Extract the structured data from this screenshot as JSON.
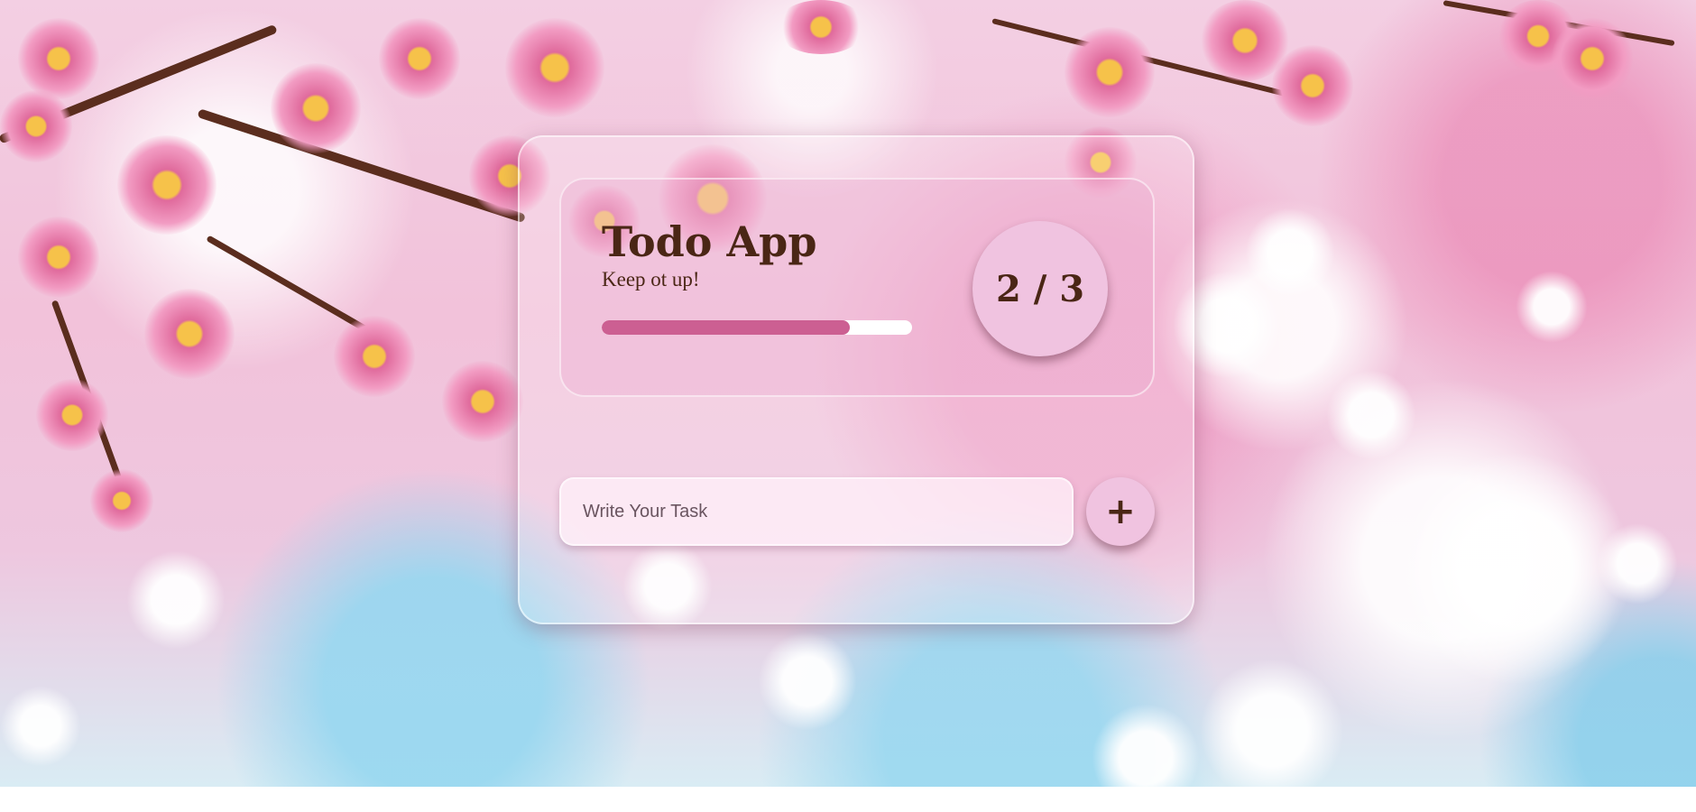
{
  "app": {
    "title": "Todo App",
    "subtitle": "Keep ot up!",
    "progress": {
      "completed": 2,
      "total": 3,
      "label": "2 / 3",
      "fraction": 0.8
    }
  },
  "new_task": {
    "placeholder": "Write Your Task",
    "value": "",
    "add_label": "+"
  },
  "colors": {
    "accent": "#cc5f92",
    "text": "#4a2615",
    "counter_bg": "#f0c3e0"
  }
}
